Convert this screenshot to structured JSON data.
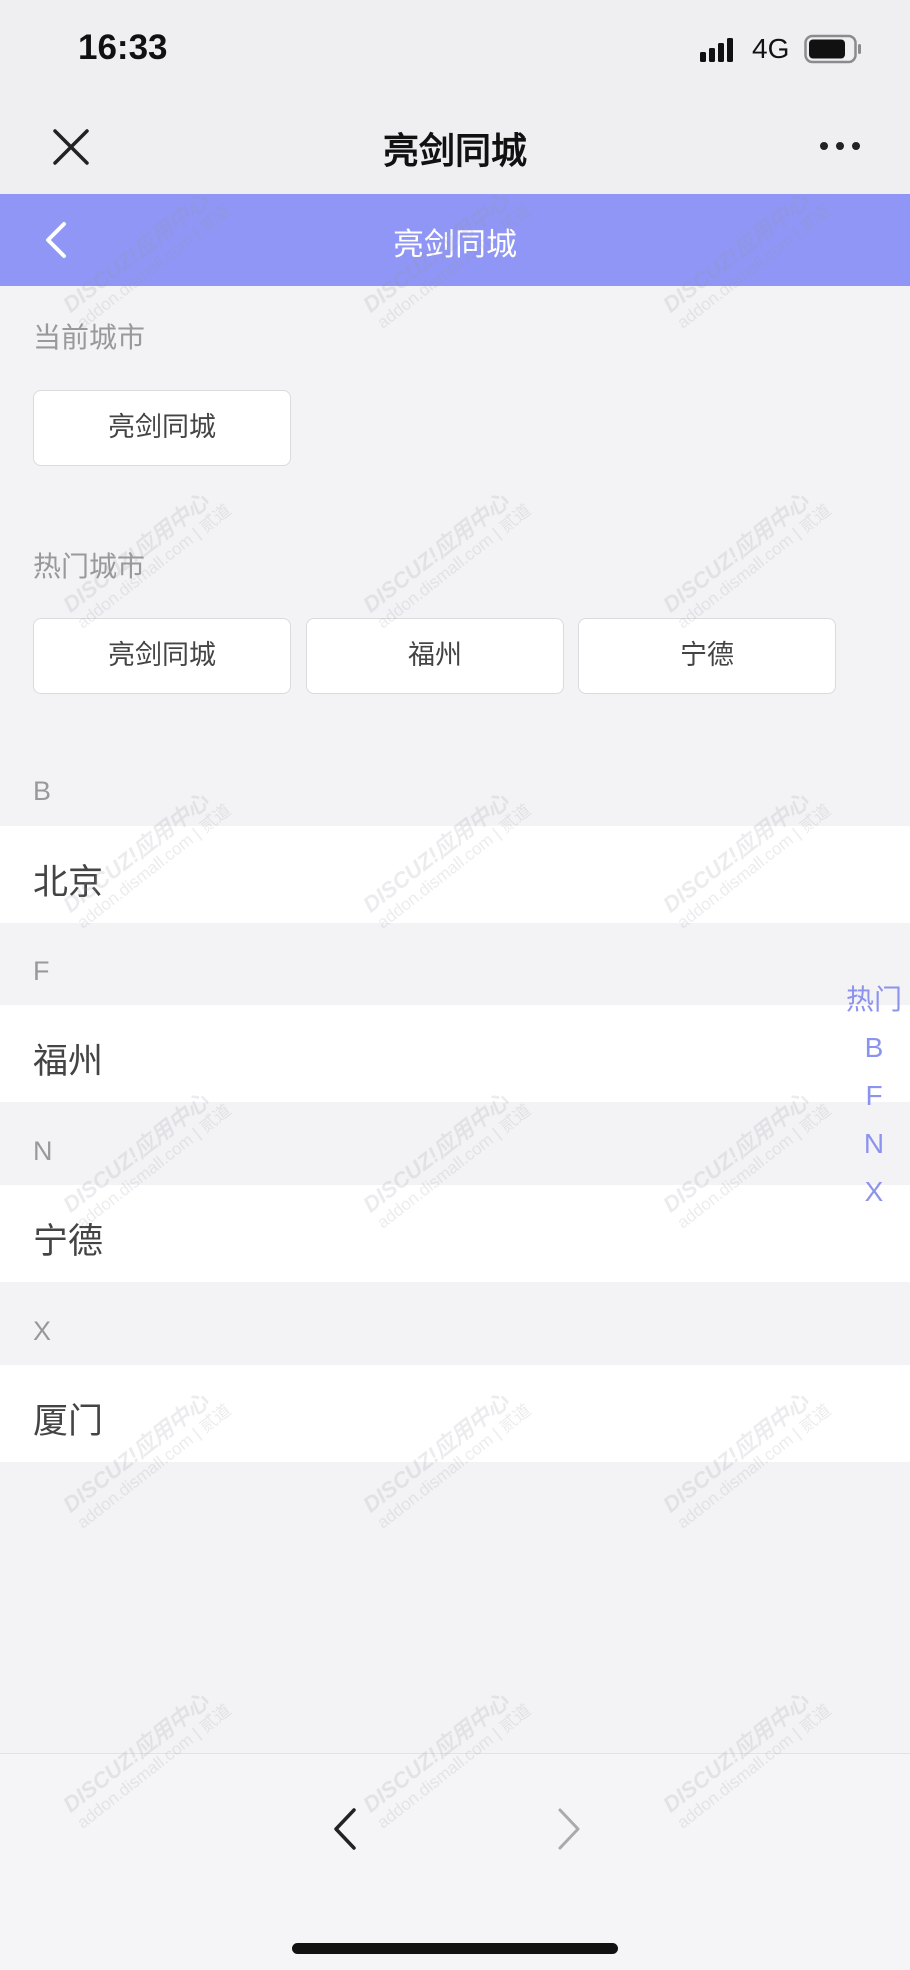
{
  "status_bar": {
    "time": "16:33",
    "network": "4G",
    "icons": [
      "signal-icon",
      "battery-icon"
    ]
  },
  "wechat_header": {
    "title": "亮剑同城",
    "icons": [
      "close-icon",
      "more-icon"
    ]
  },
  "app_nav": {
    "title": "亮剑同城",
    "back_icon": "chevron-left-icon",
    "bg_color": "#8f96f5"
  },
  "current_city": {
    "label": "当前城市",
    "city": "亮剑同城"
  },
  "hot_cities": {
    "label": "热门城市",
    "cities": [
      "亮剑同城",
      "福州",
      "宁德"
    ]
  },
  "city_groups": [
    {
      "letter": "B",
      "cities": [
        "北京"
      ]
    },
    {
      "letter": "F",
      "cities": [
        "福州"
      ]
    },
    {
      "letter": "N",
      "cities": [
        "宁德"
      ]
    },
    {
      "letter": "X",
      "cities": [
        "厦门"
      ]
    }
  ],
  "index_bar": [
    "热门",
    "B",
    "F",
    "N",
    "X"
  ],
  "accent_color": "#8c93ee",
  "watermark": {
    "brand": "DISCUZ!应用中心",
    "site": "addon.dismall.com",
    "mark": "| 贰道"
  },
  "bottom_toolbar": {
    "icons": [
      "back-arrow-icon",
      "forward-arrow-icon"
    ]
  }
}
